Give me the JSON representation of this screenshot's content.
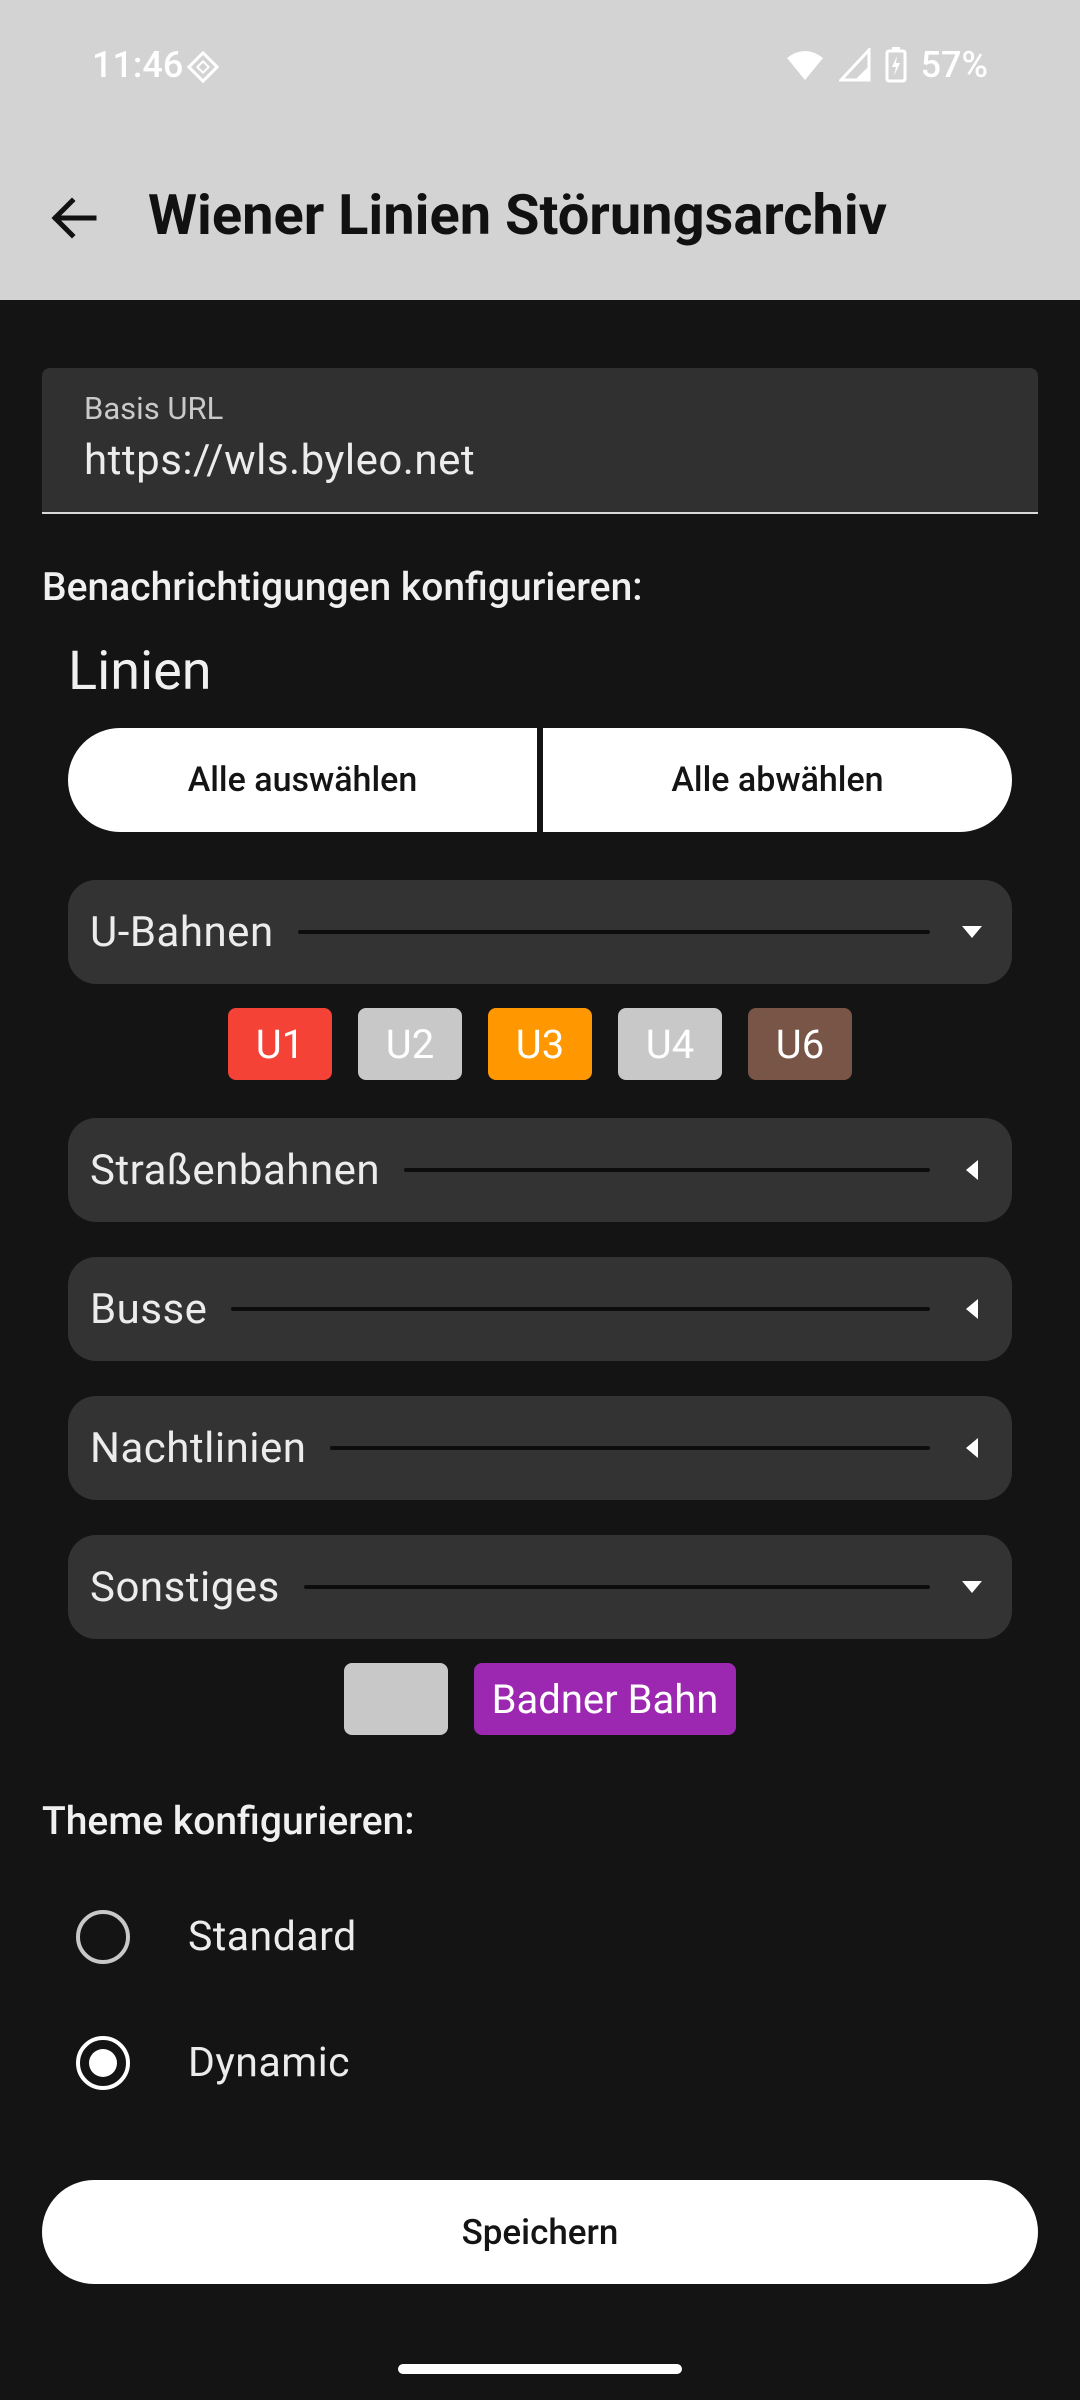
{
  "status_bar": {
    "time": "11:46",
    "battery": "57%"
  },
  "app_bar": {
    "title": "Wiener Linien Störungsarchiv"
  },
  "url_field": {
    "label": "Basis URL",
    "value": "https://wls.byleo.net"
  },
  "notifications": {
    "heading": "Benachrichtigungen konfigurieren:",
    "subheading": "Linien",
    "select_all": "Alle auswählen",
    "deselect_all": "Alle abwählen",
    "categories": [
      {
        "label": "U-Bahnen",
        "expanded": true
      },
      {
        "label": "Straßenbahnen",
        "expanded": false
      },
      {
        "label": "Busse",
        "expanded": false
      },
      {
        "label": "Nachtlinien",
        "expanded": false
      },
      {
        "label": "Sonstiges",
        "expanded": true
      }
    ],
    "ubahn_lines": [
      {
        "label": "U1",
        "color": "#f44336"
      },
      {
        "label": "U2",
        "color": "#c8c8c8"
      },
      {
        "label": "U3",
        "color": "#ff9800"
      },
      {
        "label": "U4",
        "color": "#c8c8c8"
      },
      {
        "label": "U6",
        "color": "#795548"
      }
    ],
    "other_lines": [
      {
        "label": "",
        "color": "#c8c8c8"
      },
      {
        "label": "Badner Bahn",
        "color": "#9c27b0"
      }
    ]
  },
  "theme": {
    "heading": "Theme konfigurieren:",
    "options": [
      {
        "label": "Standard",
        "selected": false
      },
      {
        "label": "Dynamic",
        "selected": true
      }
    ]
  },
  "save_label": "Speichern"
}
